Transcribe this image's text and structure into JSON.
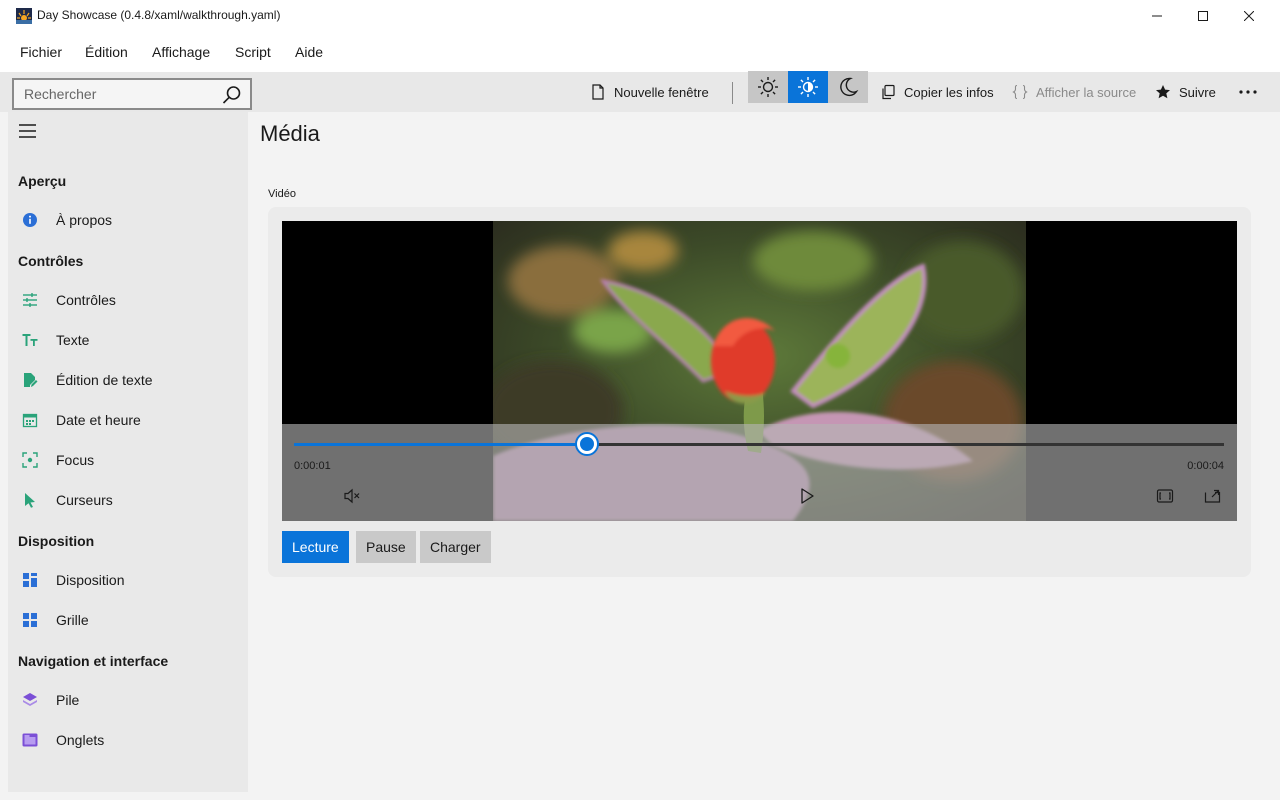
{
  "window": {
    "title": "Day Showcase (0.4.8/xaml/walkthrough.yaml)"
  },
  "menu": {
    "items": [
      "Fichier",
      "Édition",
      "Affichage",
      "Script",
      "Aide"
    ]
  },
  "toolbar": {
    "search_placeholder": "Rechercher",
    "new_window": "Nouvelle fenêtre",
    "copy_info": "Copier les infos",
    "show_source": "Afficher la source",
    "follow": "Suivre",
    "active_theme": "contrast"
  },
  "sidebar": {
    "sections": [
      {
        "header": "Aperçu",
        "items": [
          {
            "label": "À propos",
            "icon": "info-icon"
          }
        ]
      },
      {
        "header": "Contrôles",
        "items": [
          {
            "label": "Contrôles",
            "icon": "sliders-icon"
          },
          {
            "label": "Texte",
            "icon": "text-icon"
          },
          {
            "label": "Édition de texte",
            "icon": "edit-text-icon"
          },
          {
            "label": "Date et heure",
            "icon": "calendar-icon"
          },
          {
            "label": "Focus",
            "icon": "focus-icon"
          },
          {
            "label": "Curseurs",
            "icon": "cursor-icon"
          }
        ]
      },
      {
        "header": "Disposition",
        "items": [
          {
            "label": "Disposition",
            "icon": "layout-icon"
          },
          {
            "label": "Grille",
            "icon": "grid-icon"
          }
        ]
      },
      {
        "header": "Navigation et interface",
        "items": [
          {
            "label": "Pile",
            "icon": "stack-icon"
          },
          {
            "label": "Onglets",
            "icon": "tabs-icon"
          }
        ]
      }
    ]
  },
  "main": {
    "title": "Média",
    "section_label": "Vidéo",
    "player": {
      "current_time": "0:00:01",
      "total_time": "0:00:04",
      "progress": 0.315
    },
    "buttons": {
      "play": "Lecture",
      "pause": "Pause",
      "load": "Charger"
    }
  },
  "colors": {
    "accent": "#0a74d9",
    "sidebar_bg": "#e9e9e9",
    "toolbar_bg": "#e8e8e8"
  }
}
